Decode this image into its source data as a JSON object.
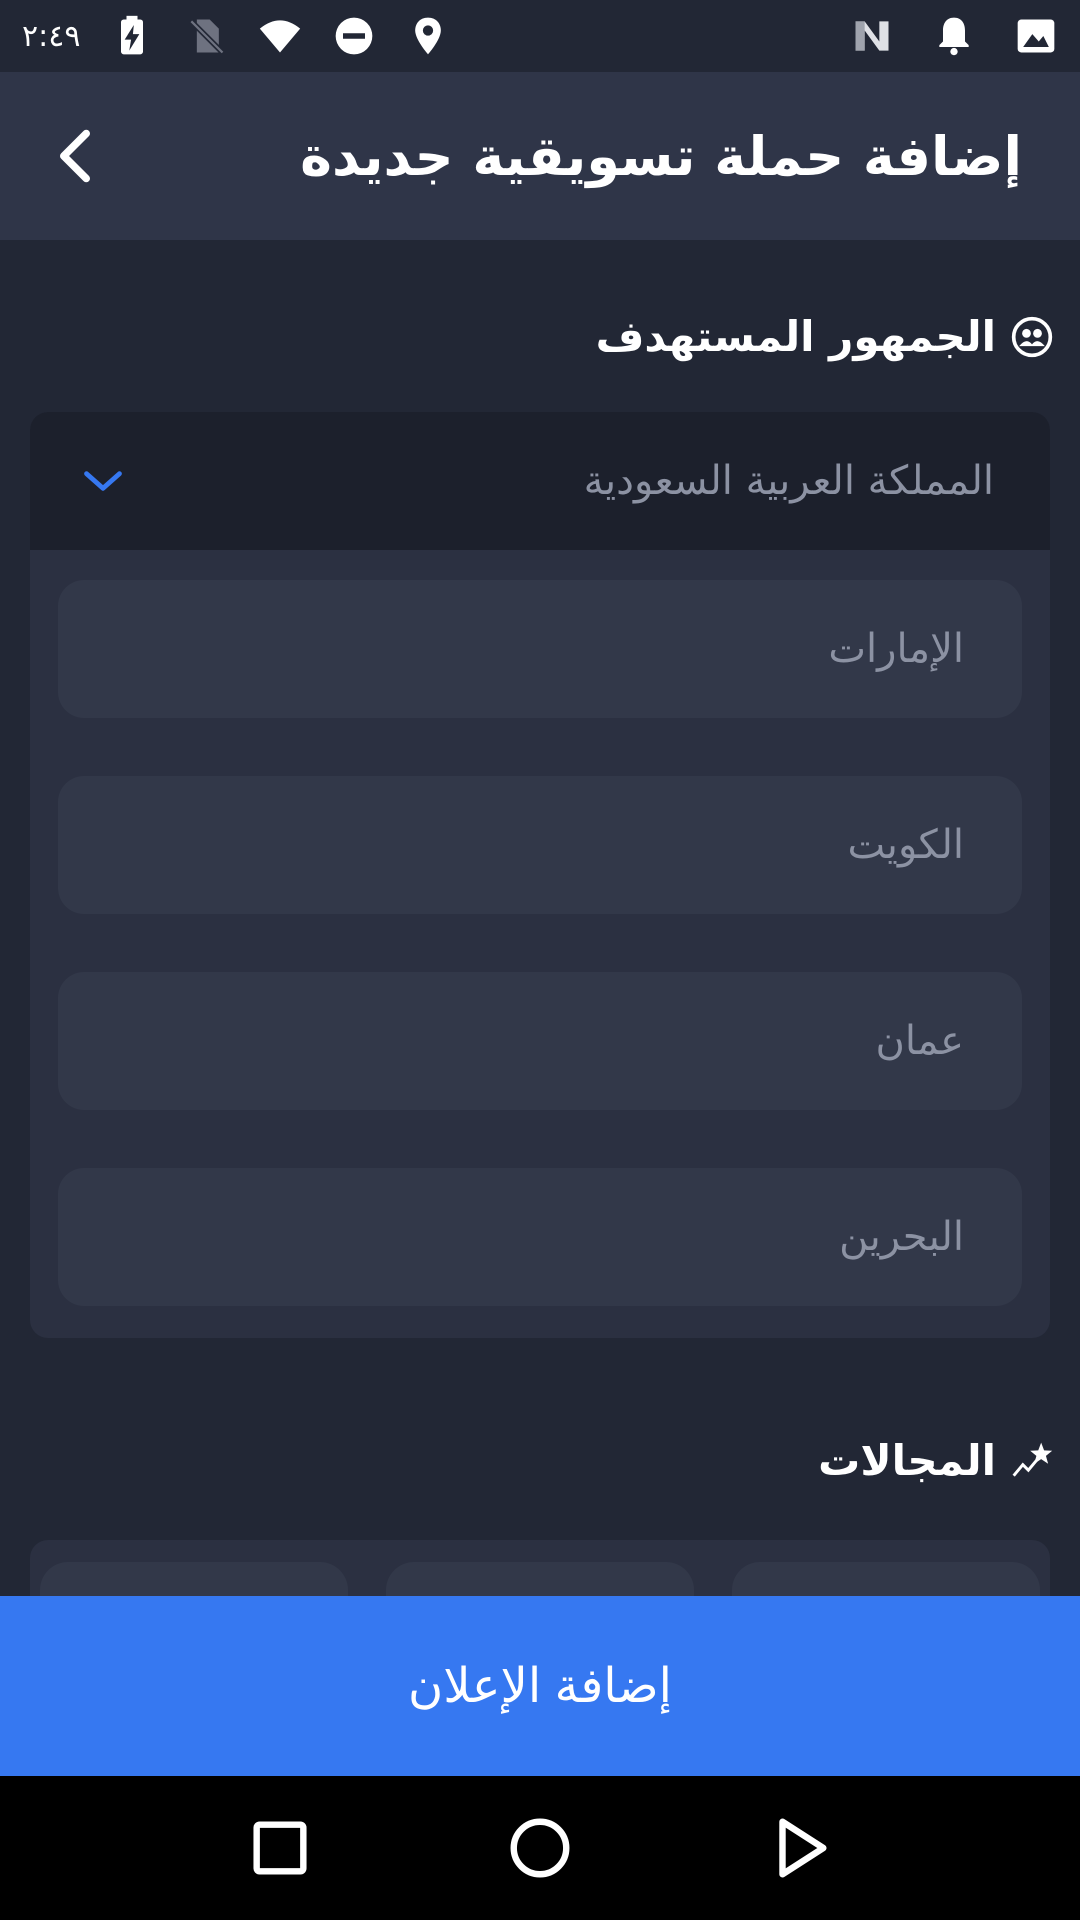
{
  "status_bar": {
    "time": "٢:٤٩",
    "icons": [
      "charging-battery-icon",
      "no-sim-icon",
      "wifi-icon",
      "do-not-disturb-icon",
      "location-icon",
      "n-notification-icon",
      "bell-icon",
      "image-icon"
    ]
  },
  "header": {
    "title": "إضافة حملة تسويقية جديدة",
    "back_icon": "back-arrow-icon"
  },
  "target_audience": {
    "title": "الجمهور المستهدف",
    "icon": "target-audience-icon",
    "selected_country": "المملكة العربية السعودية",
    "options": [
      "الإمارات",
      "الكويت",
      "عمان",
      "البحرين"
    ]
  },
  "fields": {
    "title": "المجالات",
    "icon": "trending-star-icon"
  },
  "add_button": {
    "label": "إضافة الإعلان"
  },
  "navigation": {
    "icons": [
      "recents-icon",
      "home-icon",
      "back-icon"
    ]
  },
  "colors": {
    "background": "#222735",
    "header": "#2f3548",
    "card": "#2b3041",
    "accent": "#3678f1"
  }
}
